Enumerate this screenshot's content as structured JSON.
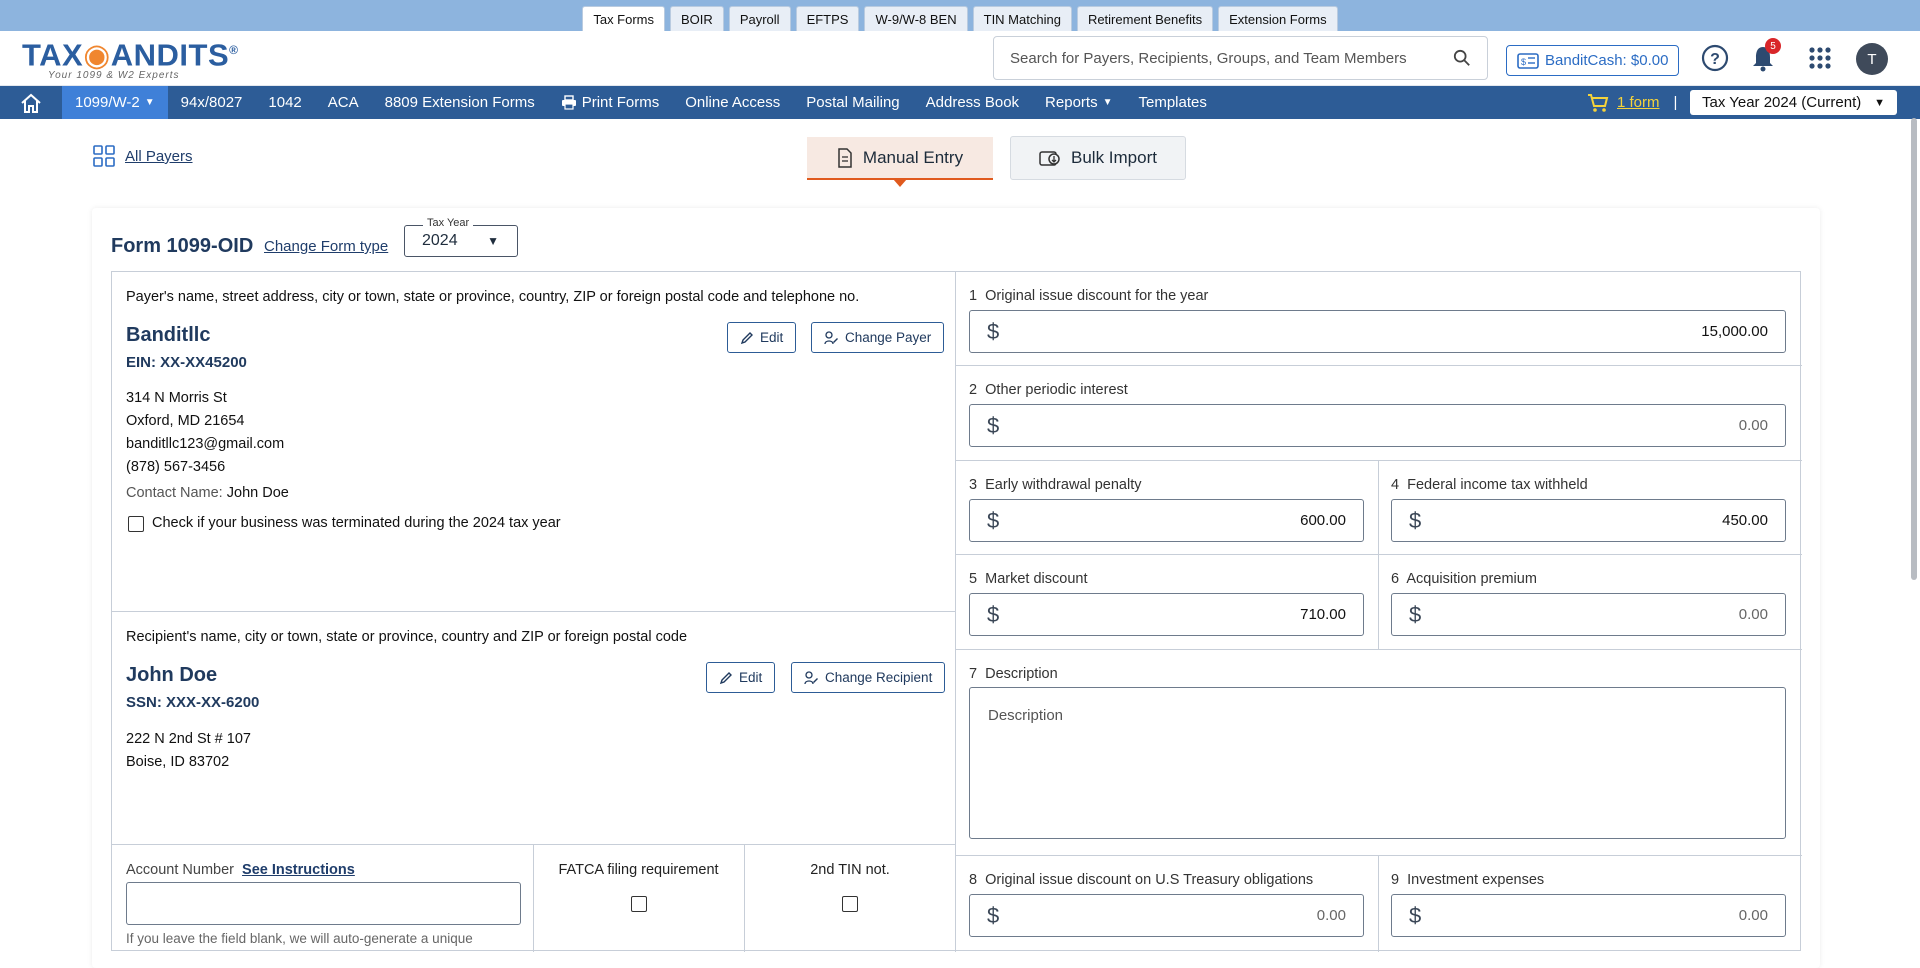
{
  "top_tabs": [
    "Tax Forms",
    "BOIR",
    "Payroll",
    "EFTPS",
    "W-9/W-8 BEN",
    "TIN Matching",
    "Retirement Benefits",
    "Extension Forms"
  ],
  "logo": {
    "text_a": "TAX",
    "text_b": "ANDITS",
    "reg": "®",
    "tagline": "Your 1099 & W2 Experts"
  },
  "search": {
    "placeholder": "Search for Payers, Recipients, Groups, and Team Members"
  },
  "bandit_cash": "BanditCash: $0.00",
  "notifications_count": "5",
  "avatar_initial": "T",
  "nav": {
    "items": [
      "1099/W-2",
      "94x/8027",
      "1042",
      "ACA",
      "8809 Extension Forms",
      "Print Forms",
      "Online Access",
      "Postal Mailing",
      "Address Book",
      "Reports",
      "Templates"
    ],
    "cart_label": "1 form",
    "separator": "|",
    "tax_year": "Tax Year 2024 (Current)"
  },
  "all_payers": "All Payers",
  "entry_tabs": {
    "manual": "Manual Entry",
    "bulk": "Bulk Import"
  },
  "form": {
    "title": "Form 1099-OID",
    "change_form": "Change Form type",
    "tax_year_label": "Tax Year",
    "tax_year_value": "2024"
  },
  "payer": {
    "section_title": "Payer's name, street address, city or town, state or province, country, ZIP or foreign postal code and telephone no.",
    "name": "Banditllc",
    "ein": "EIN: XX-XX45200",
    "address": [
      "314 N Morris St",
      "Oxford, MD 21654",
      "banditllc123@gmail.com",
      "(878) 567-3456"
    ],
    "contact_label": "Contact Name:",
    "contact_value": "John Doe",
    "terminated_label": "Check if your business was terminated during the 2024 tax year",
    "edit": "Edit",
    "change": "Change Payer"
  },
  "recipient": {
    "section_title": "Recipient's name, city or town, state or province, country and ZIP or foreign postal code",
    "name": "John Doe",
    "ssn": "SSN: XXX-XX-6200",
    "address": [
      "222 N 2nd St # 107",
      "Boise, ID 83702"
    ],
    "edit": "Edit",
    "change": "Change Recipient"
  },
  "account": {
    "label": "Account Number",
    "link": "See Instructions",
    "hint": "If you leave the field blank, we will auto-generate a unique",
    "fatca": "FATCA filing requirement",
    "tin": "2nd TIN not."
  },
  "boxes": {
    "b1": {
      "num": "1",
      "label": "Original issue discount for the year",
      "value": "15,000.00"
    },
    "b2": {
      "num": "2",
      "label": "Other periodic interest",
      "value": "0.00"
    },
    "b3": {
      "num": "3",
      "label": "Early withdrawal penalty",
      "value": "600.00"
    },
    "b4": {
      "num": "4",
      "label": "Federal income tax withheld",
      "value": "450.00"
    },
    "b5": {
      "num": "5",
      "label": "Market discount",
      "value": "710.00"
    },
    "b6": {
      "num": "6",
      "label": "Acquisition premium",
      "value": "0.00"
    },
    "b7": {
      "num": "7",
      "label": "Description",
      "placeholder": "Description"
    },
    "b8": {
      "num": "8",
      "label": "Original issue discount on U.S Treasury obligations",
      "value": "0.00"
    },
    "b9": {
      "num": "9",
      "label": "Investment expenses",
      "value": "0.00"
    }
  },
  "currency": "$"
}
